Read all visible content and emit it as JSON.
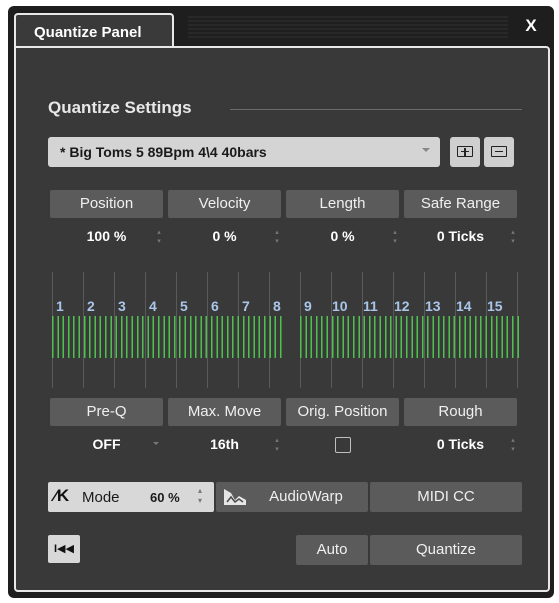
{
  "window": {
    "title": "Quantize Panel",
    "close_label": "X"
  },
  "section": {
    "title": "Quantize Settings"
  },
  "preset": {
    "value": "* Big Toms 5  89Bpm  4\\4  40bars"
  },
  "params_top": [
    {
      "label": "Position",
      "value": "100 %"
    },
    {
      "label": "Velocity",
      "value": "0 %"
    },
    {
      "label": "Length",
      "value": "0 %"
    },
    {
      "label": "Safe Range",
      "value": "0 Ticks"
    }
  ],
  "grid": {
    "numbers": [
      "1",
      "2",
      "3",
      "4",
      "5",
      "6",
      "7",
      "8",
      "9",
      "10",
      "11",
      "12",
      "13",
      "14",
      "15"
    ]
  },
  "params_bottom": [
    {
      "label": "Pre-Q",
      "value": "OFF"
    },
    {
      "label": "Max. Move",
      "value": "16th"
    },
    {
      "label": "Orig. Position",
      "value": ""
    },
    {
      "label": "Rough",
      "value": "0 Ticks"
    }
  ],
  "mode": {
    "label": "Mode",
    "value": "60 %"
  },
  "buttons": {
    "audiowarp": "AudioWarp",
    "midicc": "MIDI CC",
    "auto": "Auto",
    "quantize": "Quantize"
  },
  "icons": {
    "close": "close-icon",
    "preset_save": "preset-save-icon",
    "preset_delete": "preset-delete-icon",
    "mode": "iterative-quantize-icon",
    "audiowarp": "audiowarp-icon",
    "rewind": "rewind-icon"
  },
  "colors": {
    "panel": "#393939",
    "label_bg": "#5b5b5b",
    "grid_numbers": "#a9c6ea",
    "hits": "#4ec24e"
  }
}
